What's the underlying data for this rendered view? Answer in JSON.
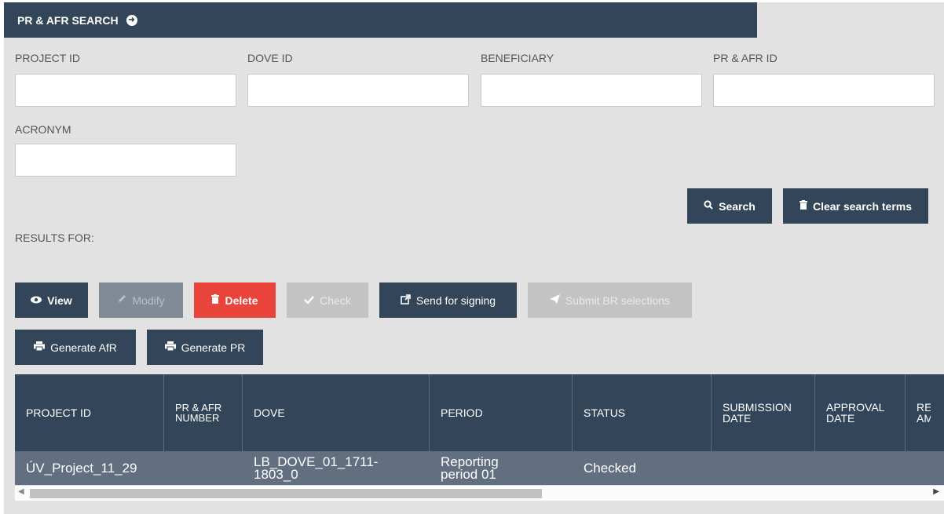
{
  "header": {
    "title": "PR & AFR SEARCH"
  },
  "fields": {
    "project_id": {
      "label": "PROJECT ID",
      "value": "",
      "placeholder": ""
    },
    "dove_id": {
      "label": "DOVE ID",
      "value": "",
      "placeholder": ""
    },
    "beneficiary": {
      "label": "BENEFICIARY",
      "value": "",
      "placeholder": ""
    },
    "pr_afr_id": {
      "label": "PR & AFR ID",
      "value": "",
      "placeholder": ""
    },
    "acronym": {
      "label": "ACRONYM",
      "value": "",
      "placeholder": ""
    }
  },
  "search_actions": {
    "search": "Search",
    "clear": "Clear search terms"
  },
  "results_label": "RESULTS FOR:",
  "toolbar": {
    "view": "View",
    "modify": "Modify",
    "delete": "Delete",
    "check": "Check",
    "send_for_signing": "Send for signing",
    "submit_br": "Submit BR selections",
    "generate_afr": "Generate AfR",
    "generate_pr": "Generate PR"
  },
  "table": {
    "columns": [
      "PROJECT ID",
      "PR & AFR NUMBER",
      "DOVE",
      "PERIOD",
      "STATUS",
      "SUBMISSION DATE",
      "APPROVAL DATE",
      "RE AM"
    ],
    "rows": [
      {
        "project_id": "ÚV_Project_11_29",
        "number": "",
        "dove": "LB_DOVE_01_1711-1803_0",
        "period": "Reporting period 01",
        "status": "Checked",
        "submission": "",
        "approval": "",
        "extra": ""
      }
    ]
  },
  "colors": {
    "header_bg": "#324559",
    "panel_bg": "#e2e2e2",
    "delete_red": "#e8443a",
    "disabled_gray": "#c3c3c3",
    "row_bg": "#616f80"
  }
}
